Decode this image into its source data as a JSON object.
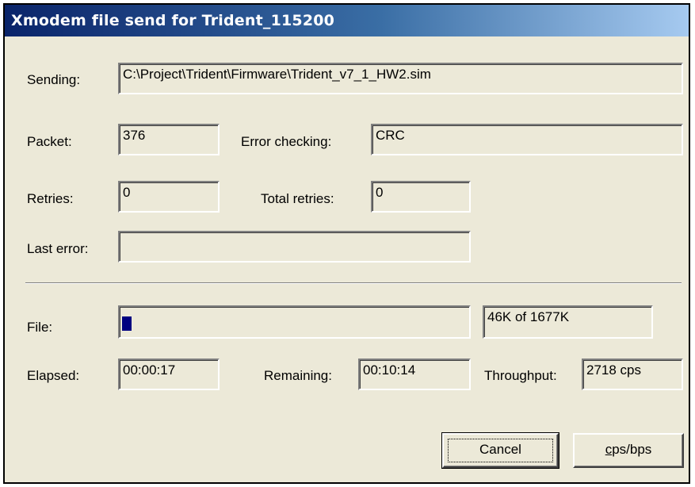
{
  "window": {
    "title": "Xmodem file send for Trident_115200"
  },
  "sending": {
    "label": "Sending:",
    "value": "C:\\Project\\Trident\\Firmware\\Trident_v7_1_HW2.sim"
  },
  "packet": {
    "label": "Packet:",
    "value": "376"
  },
  "error_checking": {
    "label": "Error checking:",
    "value": "CRC"
  },
  "retries": {
    "label": "Retries:",
    "value": "0"
  },
  "total_retries": {
    "label": "Total retries:",
    "value": "0"
  },
  "last_error": {
    "label": "Last error:",
    "value": ""
  },
  "file": {
    "label": "File:",
    "progress_fraction": 0.0274,
    "progress_text": "46K of 1677K"
  },
  "elapsed": {
    "label": "Elapsed:",
    "value": "00:00:17"
  },
  "remaining": {
    "label": "Remaining:",
    "value": "00:10:14"
  },
  "throughput": {
    "label": "Throughput:",
    "value": "2718 cps"
  },
  "buttons": {
    "cancel": "Cancel",
    "cps_bps": "cps/bps"
  },
  "colors": {
    "title_start": "#0a246a",
    "title_end": "#a6caf0",
    "window_bg": "#ece9d8",
    "progress": "#000080"
  }
}
